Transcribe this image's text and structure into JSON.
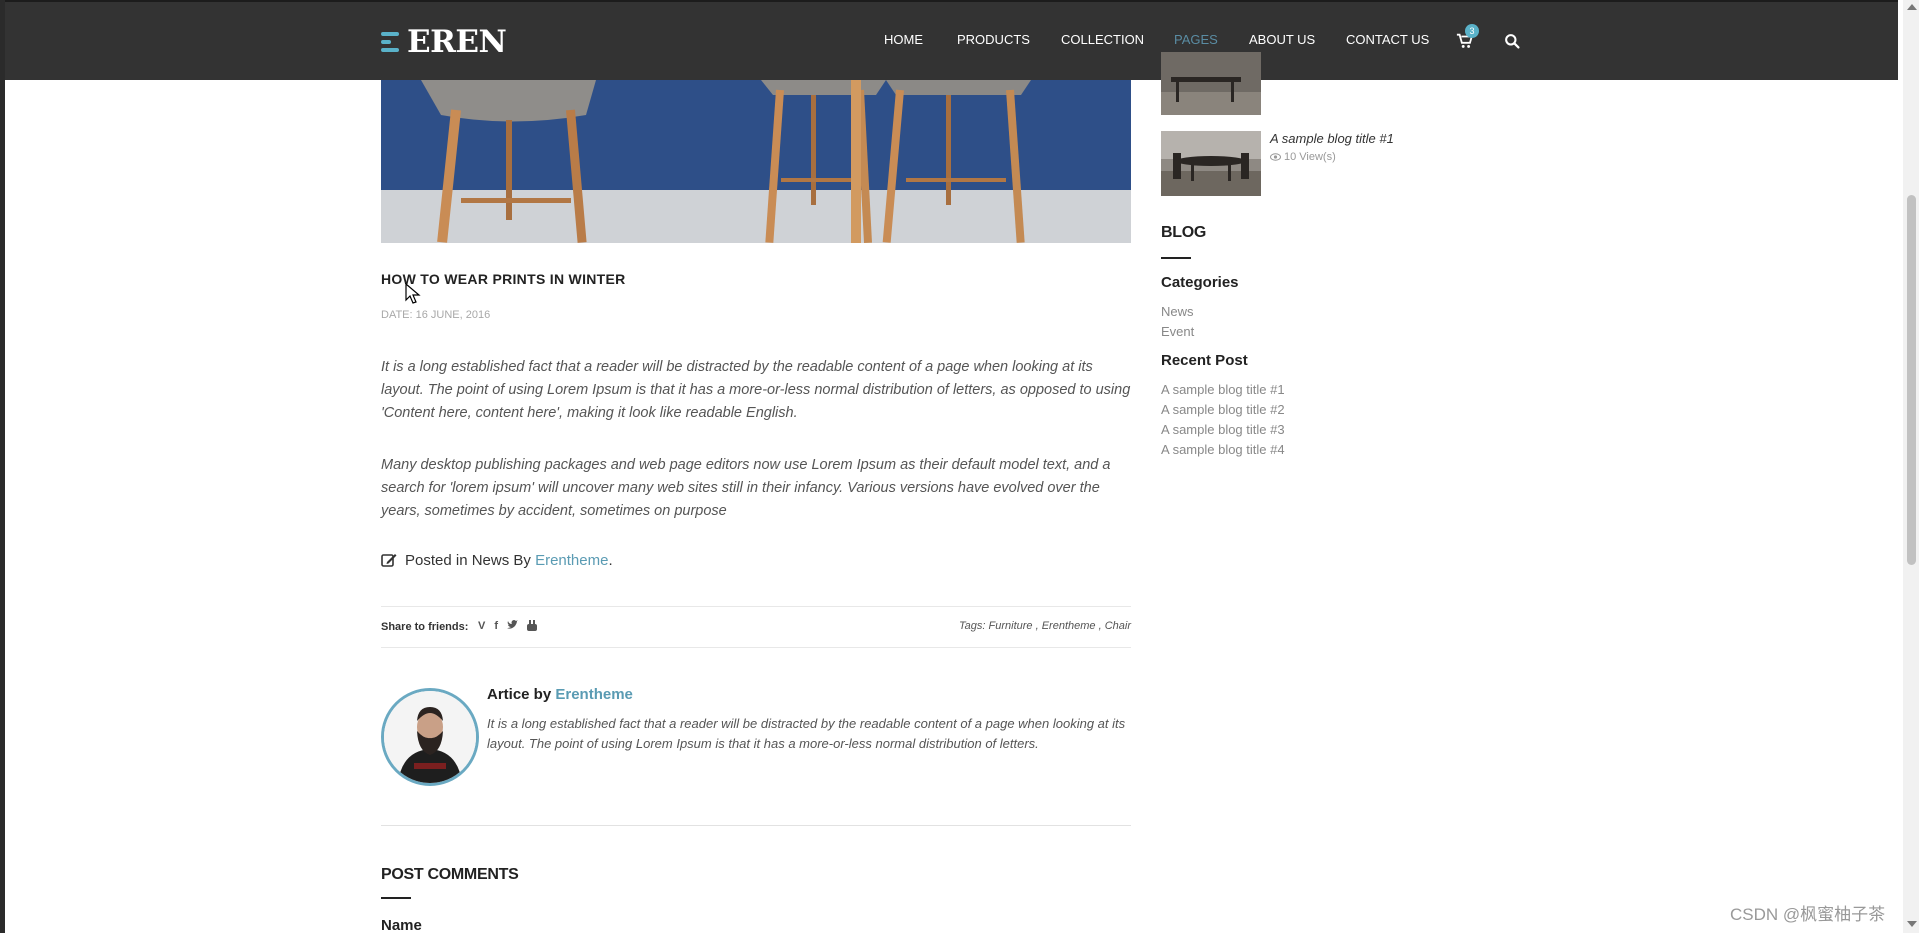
{
  "header": {
    "logo_text": "EREN",
    "nav": [
      {
        "label": "HOME"
      },
      {
        "label": "PRODUCTS"
      },
      {
        "label": "COLLECTION"
      },
      {
        "label": "PAGES"
      },
      {
        "label": "ABOUT US"
      },
      {
        "label": "CONTACT US"
      }
    ],
    "active_nav": "PAGES",
    "cart_count": "3",
    "accent_color": "#5ab2c9"
  },
  "post": {
    "title": "HOW TO WEAR PRINTS IN WINTER",
    "date": "DATE: 16 JUNE, 2016",
    "paragraphs": [
      "It is a long established fact that a reader will be distracted by the readable content of a page when looking at its layout. The point of using Lorem Ipsum is that it has a more-or-less normal distribution of letters, as opposed to using 'Content here, content here', making it look like readable English.",
      "Many desktop publishing packages and web page editors now use Lorem Ipsum as their default model text, and a search for 'lorem ipsum' will uncover many web sites still in their infancy. Various versions have evolved over the years, sometimes by accident, sometimes on purpose"
    ],
    "posted_prefix": "Posted in News By",
    "posted_author": "Erentheme",
    "posted_suffix": ".",
    "share_label": "Share to friends:",
    "share_icons": [
      "vimeo-icon",
      "facebook-icon",
      "twitter-icon",
      "youtube-icon"
    ],
    "tags_label": "Tags:",
    "tags": [
      "Furniture",
      "Erentheme",
      "Chair"
    ],
    "author_prefix": "Artice by",
    "author_name": "Erentheme",
    "author_text": "It is a long established fact that a reader will be distracted by the readable content of a page when looking at its layout. The point of using Lorem Ipsum is that it has a more-or-less normal distribution of letters."
  },
  "comments": {
    "heading": "POST COMMENTS",
    "name_label": "Name"
  },
  "sidebar": {
    "popular": [
      {
        "title": "A sample blog title #1",
        "views": "10 View(s)"
      }
    ],
    "blog_heading": "BLOG",
    "categories_heading": "Categories",
    "categories": [
      "News",
      "Event"
    ],
    "recent_heading": "Recent Post",
    "recent_posts": [
      "A sample blog title #1",
      "A sample blog title #2",
      "A sample blog title #3",
      "A sample blog title #4"
    ]
  },
  "watermark": "CSDN @枫蜜柚子茶"
}
